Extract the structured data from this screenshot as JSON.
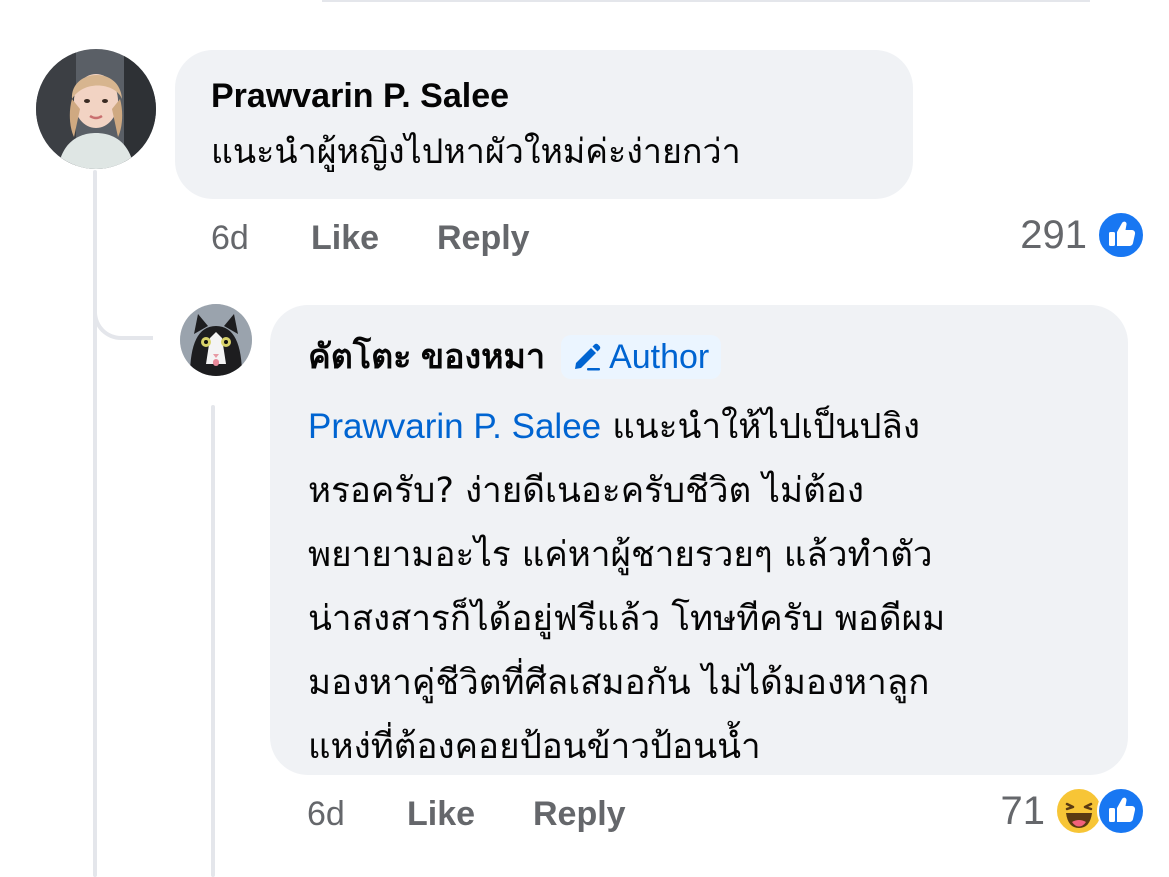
{
  "comments": [
    {
      "author": "Prawvarin P. Salee",
      "text": "แนะนำผู้หญิงไปหาผัวใหม่ค่ะง่ายกว่า",
      "time": "6d",
      "like_label": "Like",
      "reply_label": "Reply",
      "reaction_count": "291",
      "reactions": [
        "like-icon"
      ]
    }
  ],
  "reply": {
    "author": "คัตโตะ ของหมา",
    "badge_label": "Author",
    "badge_icon": "pencil-icon",
    "mention": "Prawvarin P. Salee",
    "lines": [
      " แนะนำให้ไปเป็นปลิง",
      "หรอครับ? ง่ายดีเนอะครับชีวิต ไม่ต้อง",
      "พยายามอะไร แค่หาผู้ชายรวยๆ แล้วทำตัว",
      "น่าสงสารก็ได้อยู่ฟรีแล้ว โทษทีครับ พอดีผม",
      "มองหาคู่ชีวิตที่ศีลเสมอกัน ไม่ได้มองหาลูก",
      "แหง่ที่ต้องคอยป้อนข้าวป้อนน้ำ"
    ],
    "time": "6d",
    "like_label": "Like",
    "reply_label": "Reply",
    "reaction_count": "71",
    "reactions": [
      "haha-icon",
      "like-icon"
    ]
  },
  "colors": {
    "bubble": "#f0f2f5",
    "link_blue": "#0064d1",
    "like_blue": "#1877f2",
    "meta_gray": "#65676b"
  }
}
